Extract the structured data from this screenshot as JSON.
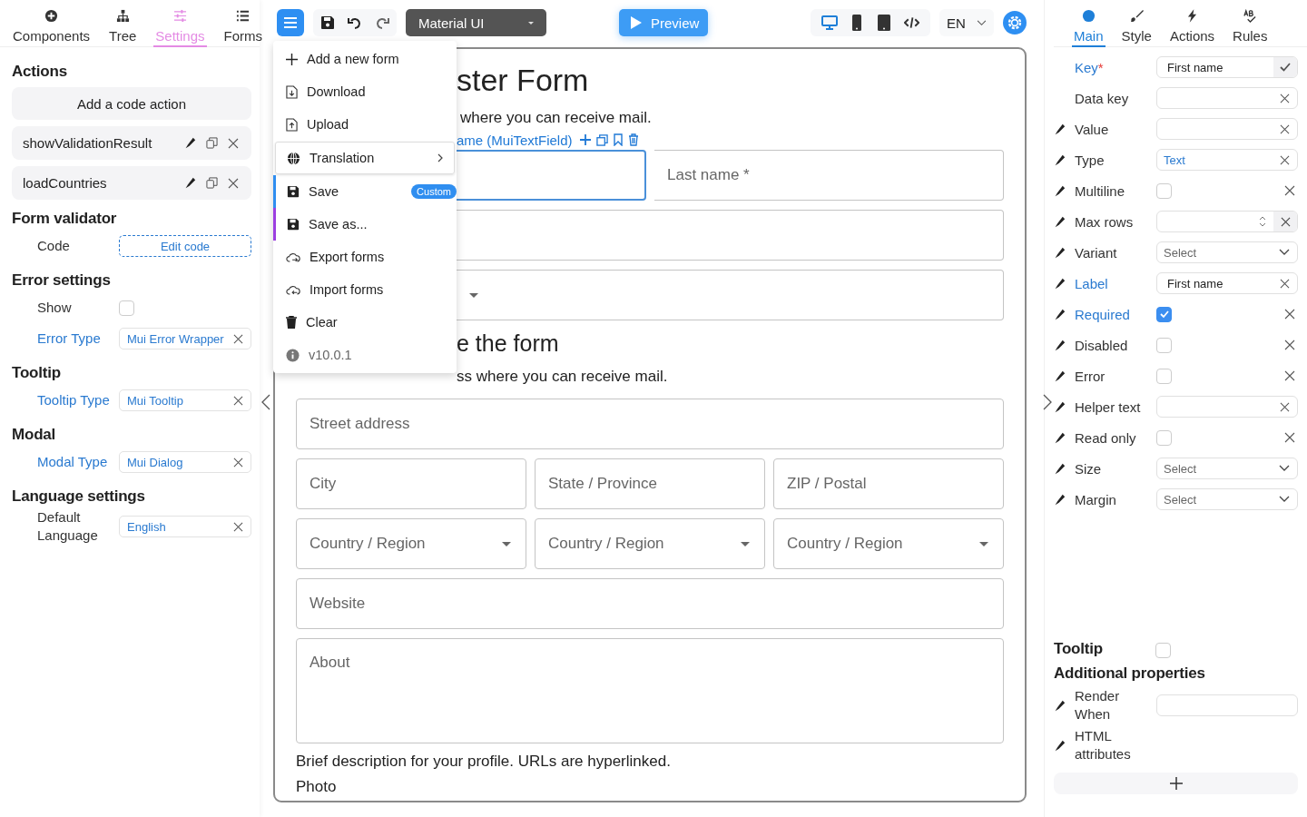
{
  "left_panel": {
    "tabs": [
      {
        "label": "Components",
        "selected": false
      },
      {
        "label": "Tree",
        "selected": false
      },
      {
        "label": "Settings",
        "selected": true
      },
      {
        "label": "Forms",
        "selected": false
      }
    ],
    "actions": {
      "title": "Actions",
      "add_button": "Add a code action",
      "items": [
        "showValidationResult",
        "loadCountries"
      ]
    },
    "sections": [
      {
        "title": "Form validator",
        "rows": [
          {
            "kind": "button",
            "label": "Code",
            "highlighted": false,
            "value": "Edit code"
          }
        ]
      },
      {
        "title": "Error settings",
        "rows": [
          {
            "kind": "checkbox",
            "label": "Show",
            "highlighted": false,
            "checked": false
          },
          {
            "kind": "select",
            "label": "Error Type",
            "highlighted": true,
            "value": "Mui Error Wrapper"
          }
        ]
      },
      {
        "title": "Tooltip",
        "rows": [
          {
            "kind": "select",
            "label": "Tooltip Type",
            "highlighted": true,
            "value": "Mui Tooltip"
          }
        ]
      },
      {
        "title": "Modal",
        "rows": [
          {
            "kind": "select",
            "label": "Modal Type",
            "highlighted": true,
            "value": "Mui Dialog"
          }
        ]
      },
      {
        "title": "Language settings",
        "rows": [
          {
            "kind": "select",
            "label": "Default Language",
            "highlighted": false,
            "value": "English"
          }
        ]
      }
    ]
  },
  "toolbar": {
    "form_type": "Material UI",
    "preview": "Preview",
    "devices": [
      {
        "selected": true
      },
      {
        "selected": false
      },
      {
        "selected": false
      },
      {
        "selected": false
      }
    ],
    "language": "EN"
  },
  "menu": {
    "items": [
      {
        "kind": "item",
        "label": "Add a new form",
        "selected": false
      },
      {
        "kind": "item",
        "label": "Download",
        "selected": false
      },
      {
        "kind": "item",
        "label": "Upload",
        "selected": false
      },
      {
        "kind": "submenu",
        "label": "Translation",
        "selected": true
      },
      {
        "kind": "item",
        "label": "Save",
        "selected": false,
        "badge": "Custom",
        "color": "#2f8ef0"
      },
      {
        "kind": "item",
        "label": "Save as...",
        "selected": false,
        "color": "#9c3fe0"
      },
      {
        "kind": "item",
        "label": "Export forms",
        "selected": false
      },
      {
        "kind": "item",
        "label": "Import forms",
        "selected": false
      },
      {
        "kind": "item",
        "label": "Clear",
        "selected": false
      },
      {
        "kind": "version",
        "label": "v10.0.1",
        "selected": false
      }
    ]
  },
  "canvas": {
    "top_blocks": [
      {
        "kind": "heading",
        "text": "ster Form"
      },
      {
        "kind": "text",
        "text": "where you can receive mail."
      },
      {
        "kind": "row",
        "fields": [
          {
            "kind": "input",
            "selected": true,
            "caption": "ame (MuiTextField)"
          },
          {
            "kind": "input",
            "selected": false,
            "placeholder": "Last name *"
          }
        ]
      },
      {
        "kind": "row",
        "fields": [
          {
            "kind": "input",
            "selected": false
          }
        ]
      },
      {
        "kind": "row",
        "fields": [
          {
            "kind": "select",
            "selected": false
          }
        ]
      },
      {
        "kind": "subheading",
        "text": "e the form"
      },
      {
        "kind": "text",
        "text": "ss where you can receive mail."
      }
    ],
    "blocks": [
      {
        "kind": "row",
        "fields": [
          {
            "kind": "input",
            "selected": false,
            "placeholder": "Street address"
          }
        ]
      },
      {
        "kind": "row",
        "fields": [
          {
            "kind": "input",
            "selected": false,
            "placeholder": "City"
          },
          {
            "kind": "input",
            "selected": false,
            "placeholder": "State / Province"
          },
          {
            "kind": "input",
            "selected": false,
            "placeholder": "ZIP / Postal"
          }
        ]
      },
      {
        "kind": "row",
        "fields": [
          {
            "kind": "select",
            "selected": false,
            "placeholder": "Country / Region"
          },
          {
            "kind": "select",
            "selected": false,
            "placeholder": "Country / Region"
          },
          {
            "kind": "select",
            "selected": false,
            "placeholder": "Country / Region"
          }
        ]
      },
      {
        "kind": "row",
        "fields": [
          {
            "kind": "input",
            "selected": false,
            "placeholder": "Website"
          }
        ]
      },
      {
        "kind": "row",
        "fields": [
          {
            "kind": "textarea",
            "selected": false,
            "placeholder": "About"
          }
        ]
      },
      {
        "kind": "text",
        "text": "Brief description for your profile. URLs are hyperlinked."
      },
      {
        "kind": "text",
        "text": "Photo"
      }
    ]
  },
  "right_panel": {
    "tabs": [
      {
        "label": "Main",
        "selected": true
      },
      {
        "label": "Style",
        "selected": false
      },
      {
        "label": "Actions",
        "selected": false
      },
      {
        "label": "Rules",
        "selected": false
      }
    ],
    "properties": [
      {
        "kind": "key",
        "label": "Key",
        "mark": "*",
        "highlighted": true,
        "bindable": false,
        "value": "First name"
      },
      {
        "kind": "text",
        "label": "Data key",
        "highlighted": false,
        "bindable": false
      },
      {
        "kind": "text",
        "label": "Value",
        "highlighted": false,
        "bindable": true
      },
      {
        "kind": "autocomplete",
        "label": "Type",
        "highlighted": false,
        "bindable": true,
        "value": "Text"
      },
      {
        "kind": "checkbox",
        "label": "Multiline",
        "highlighted": false,
        "bindable": true,
        "checked": false
      },
      {
        "kind": "number",
        "label": "Max rows",
        "highlighted": false,
        "bindable": true
      },
      {
        "kind": "select",
        "label": "Variant",
        "highlighted": false,
        "bindable": true,
        "placeholder": "Select"
      },
      {
        "kind": "text",
        "label": "Label",
        "highlighted": true,
        "bindable": true,
        "value": "First name"
      },
      {
        "kind": "checkbox",
        "label": "Required",
        "highlighted": true,
        "bindable": true,
        "checked": true
      },
      {
        "kind": "checkbox",
        "label": "Disabled",
        "highlighted": false,
        "bindable": true,
        "checked": false
      },
      {
        "kind": "checkbox",
        "label": "Error",
        "highlighted": false,
        "bindable": true,
        "checked": false
      },
      {
        "kind": "text",
        "label": "Helper text",
        "highlighted": false,
        "bindable": true
      },
      {
        "kind": "checkbox",
        "label": "Read only",
        "highlighted": false,
        "bindable": true,
        "checked": false
      },
      {
        "kind": "select",
        "label": "Size",
        "highlighted": false,
        "bindable": true,
        "placeholder": "Select"
      },
      {
        "kind": "select",
        "label": "Margin",
        "highlighted": false,
        "bindable": true,
        "placeholder": "Select"
      }
    ],
    "tooltip": {
      "label": "Tooltip",
      "checked": false
    },
    "additional": {
      "title": "Additional properties",
      "rows": [
        {
          "kind": "text",
          "label": "Render When"
        },
        {
          "kind": "none",
          "label": "HTML attributes"
        }
      ]
    }
  }
}
